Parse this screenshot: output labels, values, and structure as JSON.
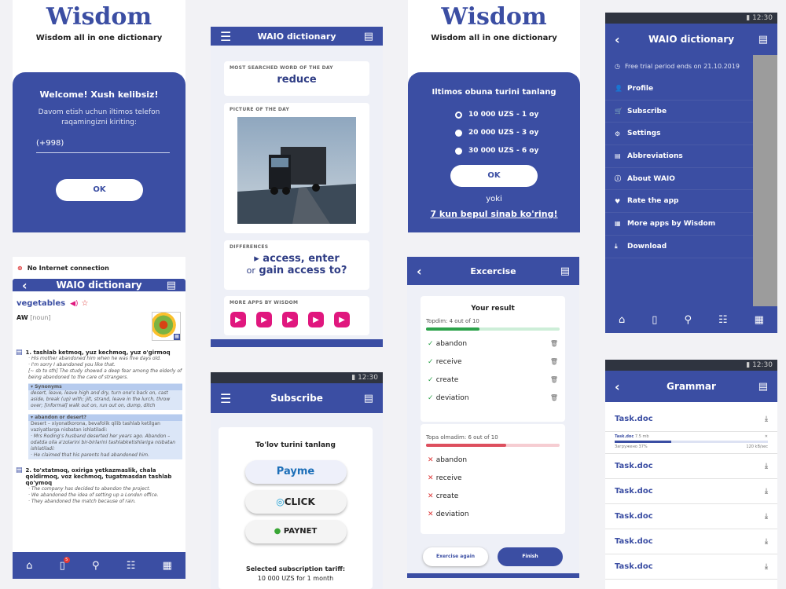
{
  "s1": {
    "logo": "Wisdom",
    "tagline": "Wisdom all in one dictionary",
    "welcome": "Welcome! Xush kelibsiz!",
    "prompt": "Davom etish uchun iltimos telefon raqamingizni kiriting:",
    "phone": "(+998)",
    "ok": "OK"
  },
  "s2": {
    "title": "WAIO dictionary",
    "wotd_label": "MOST SEARCHED WORD OF THE DAY",
    "wotd": "reduce",
    "potd_label": "PICTURE OF THE DAY",
    "diff_label": "DIFFERENCES",
    "diff_line1": "access, enter",
    "diff_or": "or",
    "diff_line2": "gain access to?",
    "more_apps_label": "MORE APPS BY WISDOM"
  },
  "s3": {
    "logo": "Wisdom",
    "tagline": "Wisdom all in one dictionary",
    "choose": "Iltimos obuna turini tanlang",
    "options": [
      "10 000 UZS - 1 oy",
      "20 000 UZS - 3 oy",
      "30 000 UZS - 6 oy"
    ],
    "ok": "OK",
    "or": "yoki",
    "trial": "7 kun bepul sinab ko'ring!"
  },
  "s4": {
    "time": "12:30",
    "title": "WAIO dictionary",
    "trial_note": "Free trial period ends on 21.10.2019",
    "menu": [
      {
        "icon": "person-icon",
        "label": "Profile"
      },
      {
        "icon": "cart-icon",
        "label": "Subscribe"
      },
      {
        "icon": "gear-icon",
        "label": "Settings"
      },
      {
        "icon": "doc-icon",
        "label": "Abbreviations"
      },
      {
        "icon": "info-icon",
        "label": "About WAIO"
      },
      {
        "icon": "heart-icon",
        "label": "Rate the app"
      },
      {
        "icon": "grid-icon",
        "label": "More apps by Wisdom"
      },
      {
        "icon": "download-icon",
        "label": "Download"
      }
    ]
  },
  "s5": {
    "no_internet": "No Internet connection",
    "title": "WAIO dictionary",
    "word": "vegetables",
    "tag": "AW",
    "pos": "[noun]",
    "def1": "1. tashlab ketmoq, yuz kechmoq, yuz o'girmoq",
    "ex1a": "· His mother abandoned him when he was five days old.",
    "ex1b": "· I'm sorry I abandoned you like that.",
    "ex1c": "[~ sb to sth] The study showed a deep fear among the elderly of being abandoned to the care of strangers.",
    "syn_head": "Synonyms",
    "syn_body": "desert, leave, leave high and dry, turn one's back on, cast aside, break (up) with; jilt, strand, leave in the lurch, throw over; [informal] walk out on, run out on, dump, ditch",
    "ab_head": "abandon or desert?",
    "ab_body": "Desert – xiyonatkorona, bevafolik qilib tashlab ketilgan vaziyatlarga nisbatan ishlatiladi:",
    "ab_ex1": "· Mrs Roding's husband deserted her years ago. Abandon – odatda oila a'zolarini bir-birlarini tashlabketishlariga nisbatan ishlatiladi:",
    "ab_ex2": "· He claimed that his parents had abandoned him.",
    "def2": "2. to'xtatmoq, oxiriga yetkazmaslik, chala qoldirmoq, voz kechmoq, tugatmasdan tashlab qo'ymoq",
    "ex2a": "· The company has decided to abandon the project.",
    "ex2b": "· We abandoned the idea of setting up a London office.",
    "ex2c": "· They abandoned the match because of rain.",
    "badge": "5"
  },
  "s6": {
    "time": "12:30",
    "title": "Subscribe",
    "choose": "To'lov turini tanlang",
    "pay1": "Payme",
    "pay2": "CLICK",
    "pay3": "PAYNET",
    "selected_label": "Selected subscription tariff:",
    "selected_value": "10 000 UZS for 1 month"
  },
  "s7": {
    "title": "Excercise",
    "result": "Your result",
    "found": "Topdim: 4 out of 10",
    "found_pct": 0.4,
    "right": [
      "abandon",
      "receive",
      "create",
      "deviation"
    ],
    "notfound": "Topa olmadim: 6 out of 10",
    "notfound_pct": 0.6,
    "wrong": [
      "abandon",
      "receive",
      "create",
      "deviation"
    ],
    "again": "Exercise again",
    "finish": "Finish"
  },
  "s8": {
    "time": "12:30",
    "title": "Grammar",
    "files": [
      "Task.doc",
      "Task.doc",
      "Task.doc",
      "Task.doc",
      "Task.doc",
      "Task.doc"
    ],
    "dl_name": "Task.doc",
    "dl_size": "7.5 mb",
    "dl_status": "Загружено 37%",
    "dl_speed": "120 kB/sec",
    "dl_progress": 0.37
  }
}
